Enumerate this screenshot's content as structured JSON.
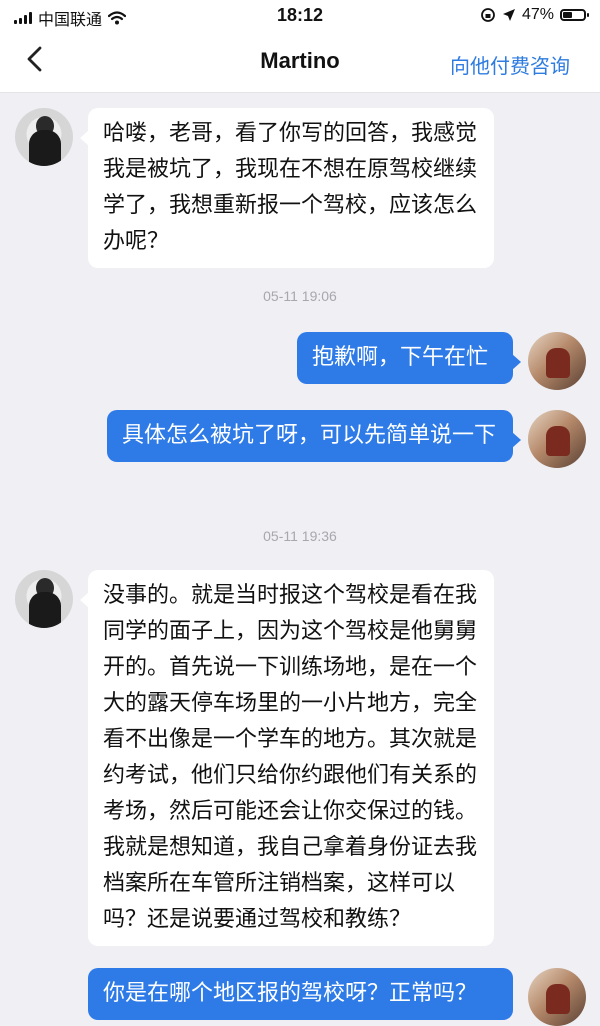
{
  "status_bar": {
    "carrier": "中国联通",
    "time": "18:12",
    "battery": "47%",
    "battery_level": 0.47
  },
  "header": {
    "title": "Martino",
    "action_label": "向他付费咨询"
  },
  "messages": [
    {
      "direction": "in",
      "text": "哈喽，老哥，看了你写的回答，我感觉我是被坑了，我现在不想在原驾校继续学了，我想重新报一个驾校，应该怎么办呢？"
    },
    {
      "timestamp": "05-11 19:06"
    },
    {
      "direction": "out",
      "text": "抱歉啊，下午在忙"
    },
    {
      "direction": "out",
      "text": "具体怎么被坑了呀，可以先简单说一下"
    },
    {
      "timestamp": "05-11 19:36"
    },
    {
      "direction": "in",
      "text": "没事的。就是当时报这个驾校是看在我同学的面子上，因为这个驾校是他舅舅开的。首先说一下训练场地，是在一个大的露天停车场里的一小片地方，完全看不出像是一个学车的地方。其次就是约考试，他们只给你约跟他们有关系的考场，然后可能还会让你交保过的钱。我就是想知道，我自己拿着身份证去我档案所在车管所注销档案，这样可以吗？还是说要通过驾校和教练？"
    },
    {
      "direction": "out",
      "text": "你是在哪个地区报的驾校呀？正常吗？"
    }
  ]
}
